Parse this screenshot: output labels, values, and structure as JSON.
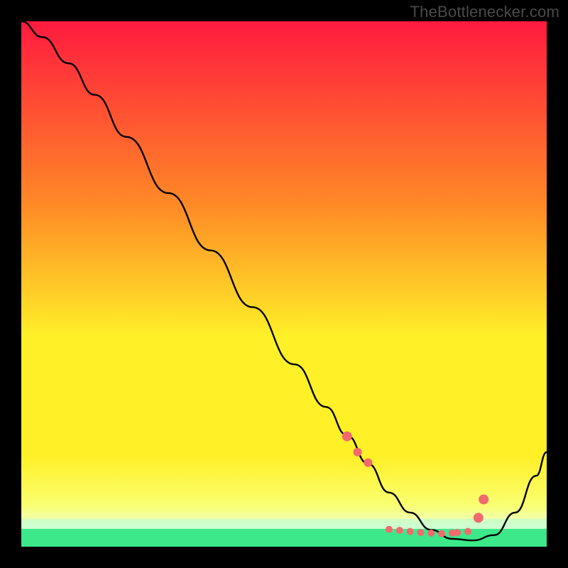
{
  "watermark": "TheBottlenecker.com",
  "colors": {
    "frame": "#000000",
    "curve": "#000000",
    "markers": "#f16a6e",
    "highlight_band": "#29e683",
    "grad_top": "#ff1a3f",
    "grad_upper_mid": "#ff8a26",
    "grad_mid": "#fff028",
    "grad_lower": "#faff70",
    "grad_bottom_pale": "#ecffc6"
  },
  "chart_data": {
    "type": "line",
    "title": "",
    "xlabel": "",
    "ylabel": "",
    "xlim": [
      0,
      100
    ],
    "ylim": [
      0,
      100
    ],
    "curve": {
      "x": [
        0,
        4,
        9,
        14,
        20,
        28,
        36,
        44,
        52,
        58,
        62,
        66,
        70,
        74,
        78,
        82,
        86,
        90,
        94,
        98,
        100
      ],
      "y": [
        100,
        97,
        92,
        86,
        78,
        67.3,
        56.4,
        45.6,
        34.7,
        26.6,
        21.2,
        15.8,
        10.3,
        6.5,
        3.2,
        1.5,
        1.2,
        2.2,
        6.5,
        13.5,
        18
      ]
    },
    "markers": {
      "x": [
        62,
        64,
        66,
        70,
        72,
        74,
        76,
        78,
        80,
        82,
        83,
        85,
        87,
        88
      ],
      "y": [
        21,
        18,
        16,
        3.3,
        3.1,
        2.9,
        2.7,
        2.6,
        2.5,
        2.6,
        2.7,
        2.9,
        5.5,
        9
      ],
      "r": [
        7,
        6,
        6,
        5,
        5,
        5,
        5,
        5,
        5,
        5,
        5,
        5,
        7,
        7
      ]
    },
    "highlight_band_y": [
      0,
      3.4
    ]
  }
}
